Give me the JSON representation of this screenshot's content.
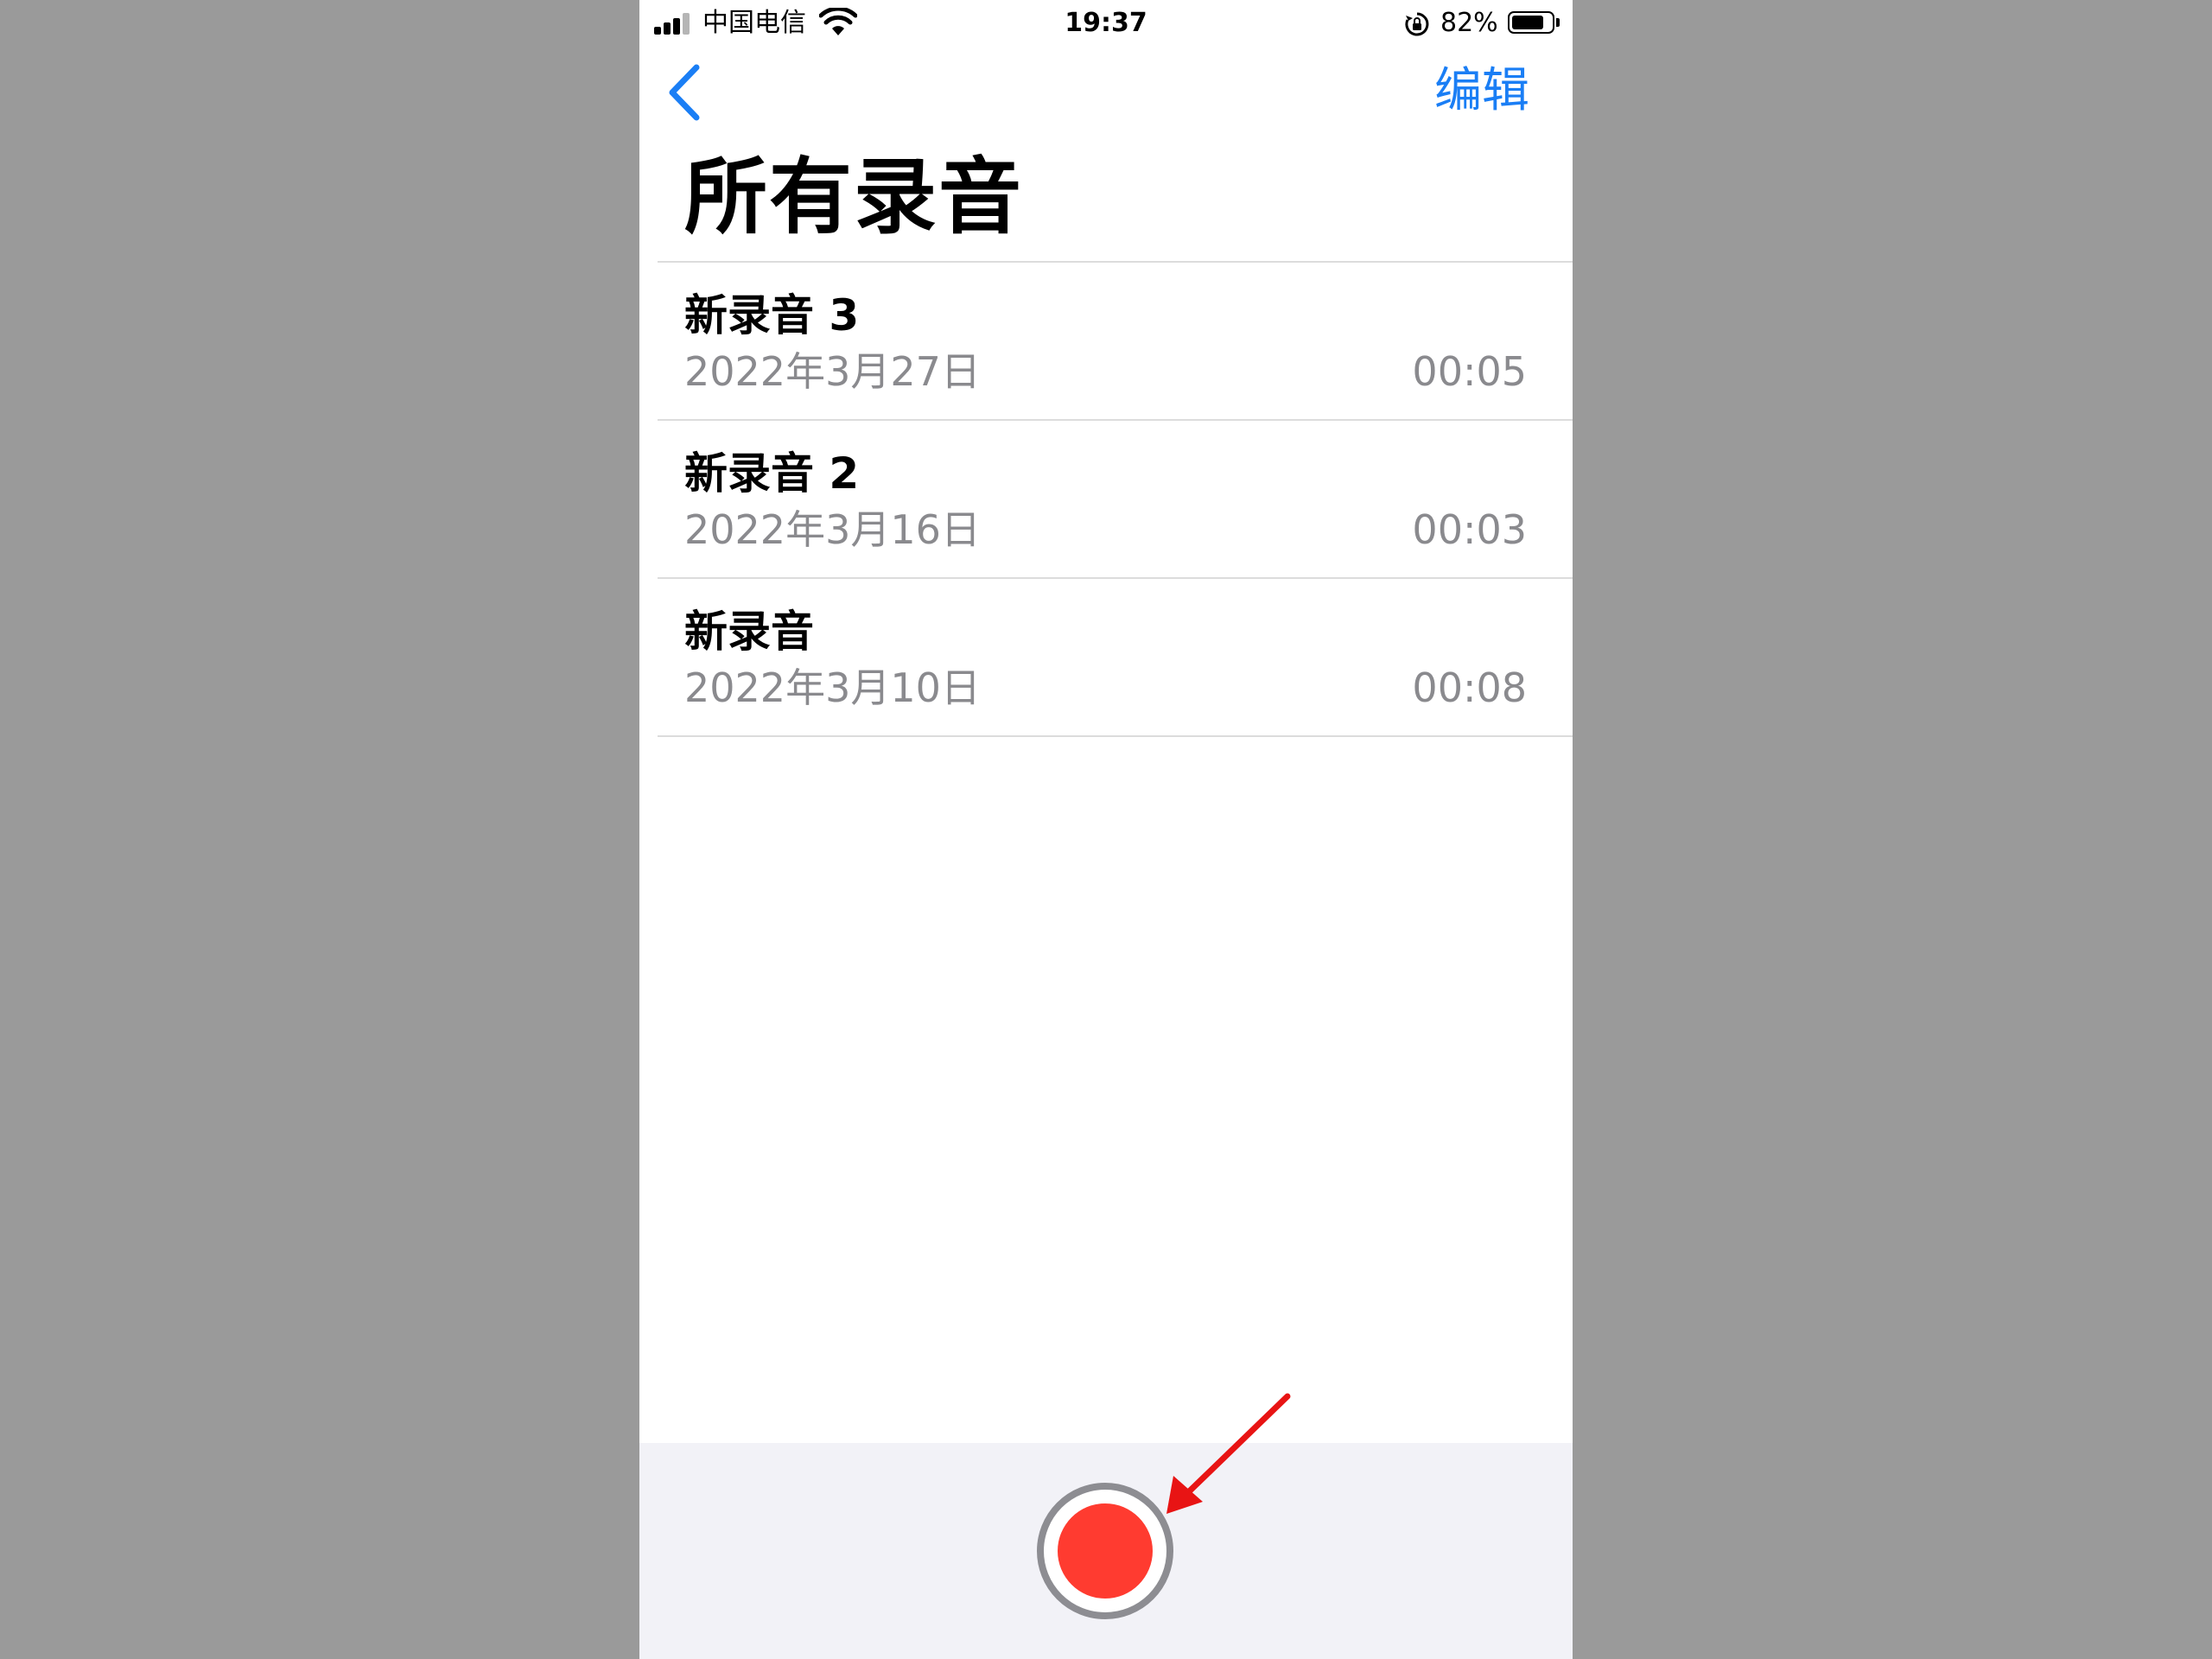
{
  "status_bar": {
    "carrier": "中国电信",
    "time": "19:37",
    "battery_percent": "82%",
    "battery_level": 0.82,
    "signal_bars": 3,
    "signal_max": 4
  },
  "nav": {
    "back_icon": "chevron-left-icon",
    "edit_label": "编辑"
  },
  "page": {
    "title": "所有录音"
  },
  "recordings": [
    {
      "name": "新录音 3",
      "date": "2022年3月27日",
      "duration": "00:05"
    },
    {
      "name": "新录音 2",
      "date": "2022年3月16日",
      "duration": "00:03"
    },
    {
      "name": "新录音",
      "date": "2022年3月10日",
      "duration": "00:08"
    }
  ],
  "colors": {
    "accent": "#1a7ef5",
    "record": "#ff3b30",
    "annotation_arrow": "#e81414",
    "secondary_text": "#8a8a8e",
    "backdrop": "#9a9a9a"
  }
}
